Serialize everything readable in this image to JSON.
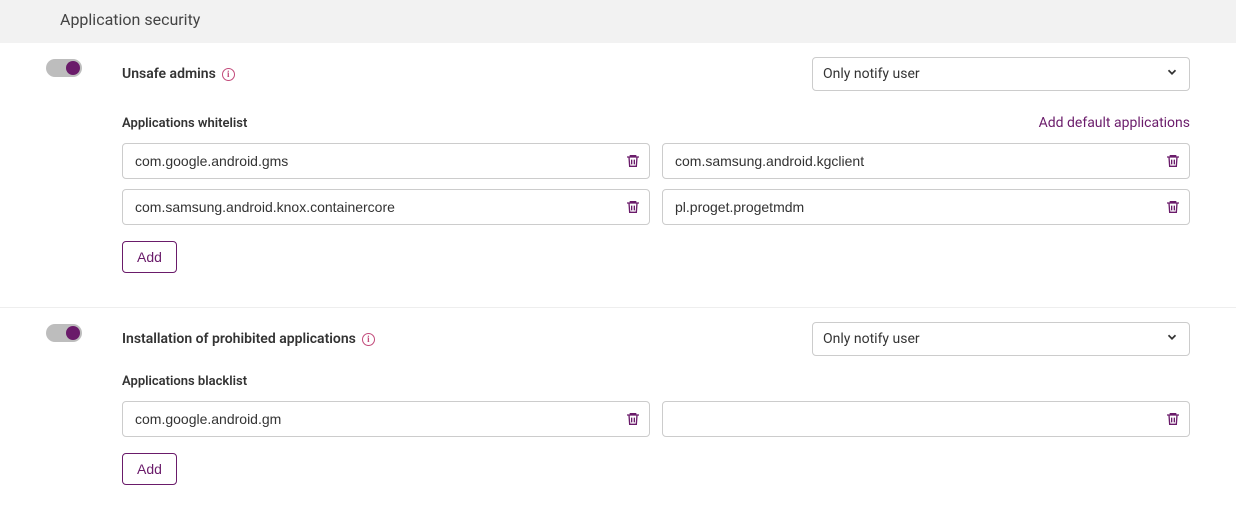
{
  "section_title": "Application security",
  "unsafe_admins": {
    "label": "Unsafe admins",
    "select_value": "Only notify user",
    "whitelist_label": "Applications whitelist",
    "add_defaults": "Add default applications",
    "items": [
      "com.google.android.gms",
      "com.samsung.android.kgclient",
      "com.samsung.android.knox.containercore",
      "pl.proget.progetmdm"
    ],
    "add_button": "Add"
  },
  "prohibited": {
    "label": "Installation of prohibited applications",
    "select_value": "Only notify user",
    "blacklist_label": "Applications blacklist",
    "items": [
      "com.google.android.gm",
      ""
    ],
    "add_button": "Add"
  }
}
